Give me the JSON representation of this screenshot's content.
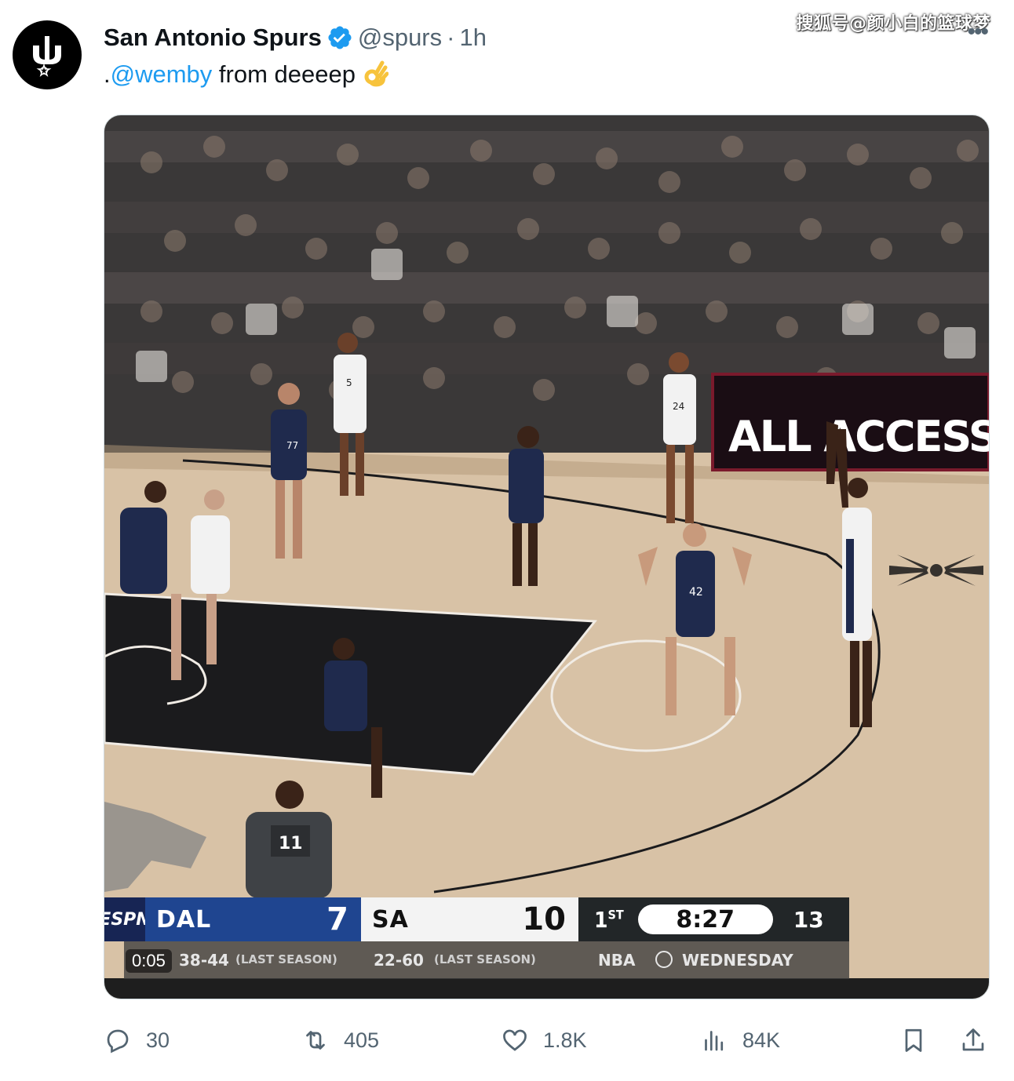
{
  "watermark": "搜狐号@颜小白的篮球梦",
  "more_menu": "•••",
  "tweet": {
    "display_name": "San Antonio Spurs",
    "handle": "@spurs",
    "separator": "·",
    "time": "1h",
    "text_prefix": ".",
    "mention": "@wemby",
    "text_rest": " from deeeep",
    "emoji": "ok-hand-emoji"
  },
  "video": {
    "elapsed": "0:05",
    "scorebug": {
      "network": "ESPN",
      "away_team": "DAL",
      "away_score": "7",
      "home_team": "SA",
      "home_score": "10",
      "period_num": "1",
      "period_suffix": "ST",
      "clock": "8:27",
      "shot_clock": "13",
      "away_record": "38-44",
      "away_record_note": "(LAST SEASON)",
      "home_record": "22-60",
      "home_record_note": "(LAST SEASON)",
      "network_label": "NBA",
      "day_label": "WEDNESDAY"
    },
    "ad_board_text": "ALL ACCESS. ALL SE",
    "referee_number": "11",
    "jersey_numbers": [
      "77",
      "42",
      "24",
      "5"
    ]
  },
  "actions": {
    "replies": "30",
    "reposts": "405",
    "likes": "1.8K",
    "views": "84K"
  },
  "colors": {
    "link": "#1d9bf0",
    "muted": "#536471",
    "away_bg": "#1f4590",
    "home_bg": "#f3f3f3",
    "clock_bg": "#222628",
    "court": "#d8c2a6",
    "paint": "#1b1b1d"
  }
}
